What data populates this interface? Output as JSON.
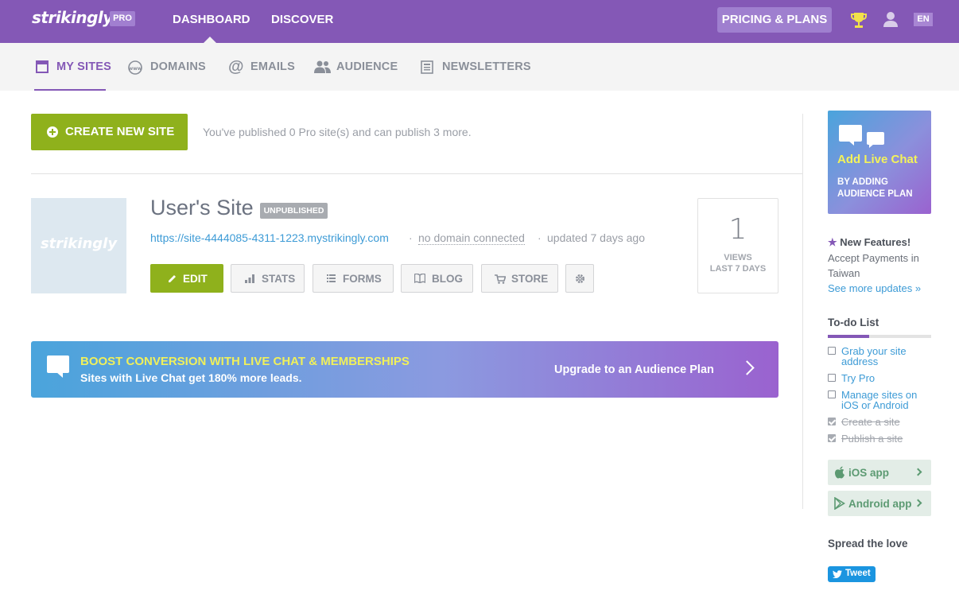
{
  "header": {
    "logo": "strikingly",
    "badge": "PRO",
    "nav": [
      "DASHBOARD",
      "DISCOVER"
    ],
    "pricing": "PRICING & PLANS",
    "lang": "EN"
  },
  "subnav": {
    "tabs": [
      "MY SITES",
      "DOMAINS",
      "EMAILS",
      "AUDIENCE",
      "NEWSLETTERS"
    ]
  },
  "main": {
    "create_label": "CREATE NEW SITE",
    "publish_note": "You've published 0 Pro site(s) and can publish 3 more.",
    "site": {
      "thumb_text": "strikingly",
      "title": "User's Site",
      "status": "UNPUBLISHED",
      "url": "https://site-4444085-4311-1223.mystrikingly.com",
      "separator": "·",
      "domain": "no domain connected",
      "updated": "updated 7 days ago",
      "buttons": [
        "EDIT",
        "STATS",
        "FORMS",
        "BLOG",
        "STORE"
      ],
      "views_count": "1",
      "views_label_1": "VIEWS",
      "views_label_2": "LAST 7 DAYS"
    },
    "banner": {
      "headline": "BOOST CONVERSION WITH LIVE CHAT & MEMBERSHIPS",
      "subline": "Sites with Live Chat get 180% more leads.",
      "cta": "Upgrade to an Audience Plan"
    }
  },
  "sidebar": {
    "promo_title": "Add Live Chat",
    "promo_sub": "BY ADDING AUDIENCE PLAN",
    "new_features_title": "New Features!",
    "new_features_text_1": "Accept Payments in",
    "new_features_text_2": "Taiwan",
    "see_more": "See more updates »",
    "todo_title": "To-do List",
    "todo_progress": 0.4,
    "todos": [
      {
        "label": "Grab your site address",
        "done": false
      },
      {
        "label": "Try Pro",
        "done": false
      },
      {
        "label": "Manage sites on iOS or Android",
        "done": false
      },
      {
        "label": "Create a site",
        "done": true
      },
      {
        "label": "Publish a site",
        "done": true
      }
    ],
    "ios_app": "iOS app",
    "android_app": "Android app",
    "spread": "Spread the love",
    "tweet": "Tweet"
  },
  "colors": {
    "brand_purple": "#8458b6",
    "create_green": "#8fb11c",
    "link_blue": "#3d9bd6"
  }
}
